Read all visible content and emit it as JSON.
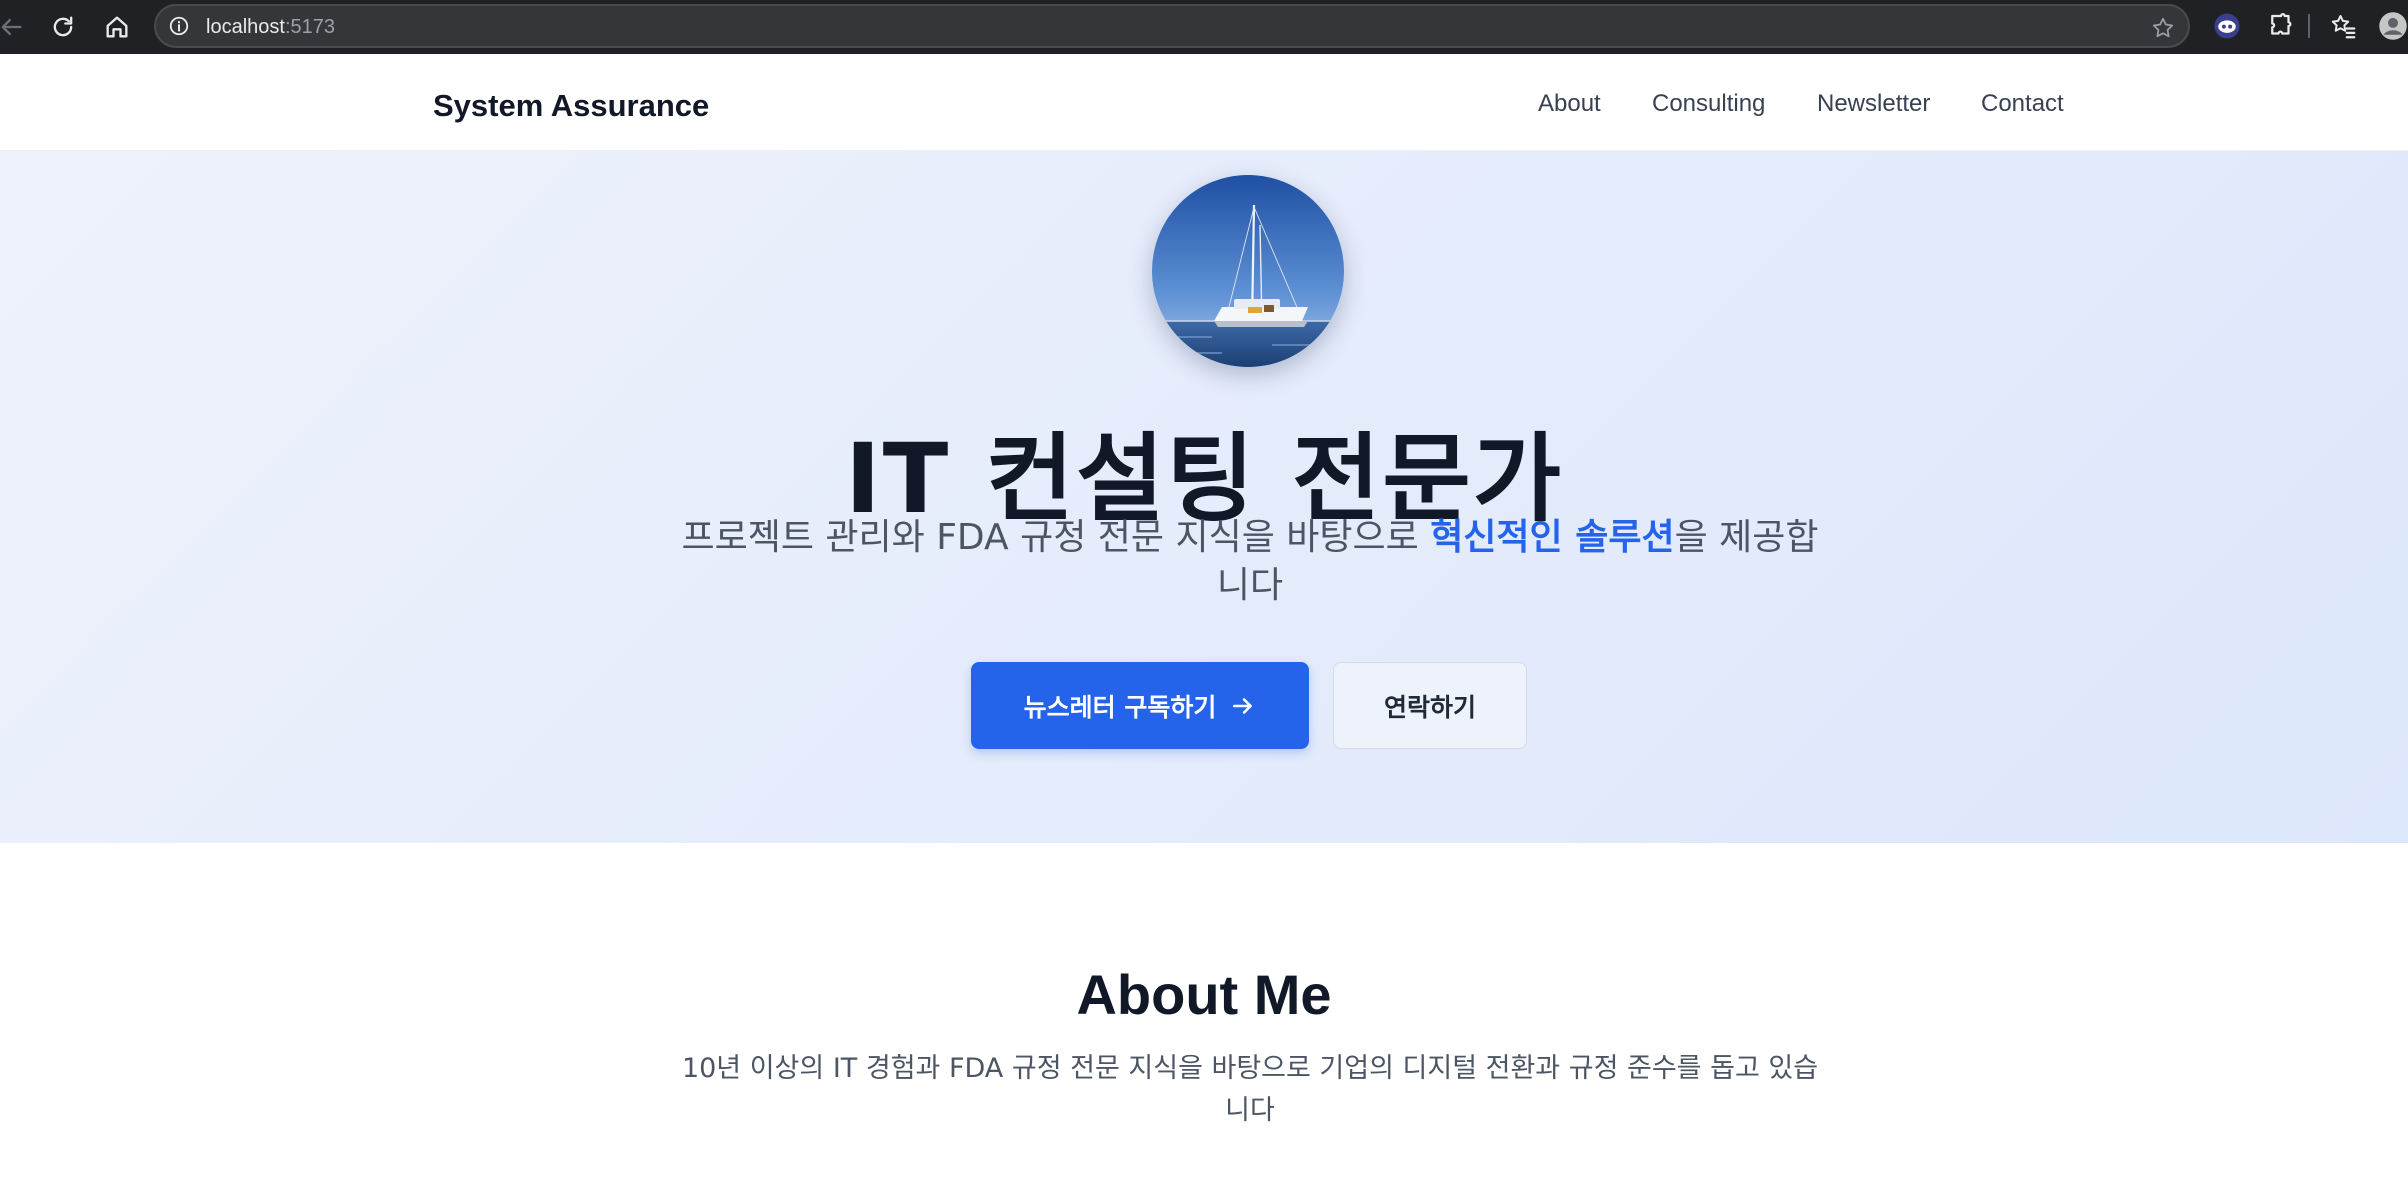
{
  "browser": {
    "url_host": "localhost",
    "url_port": ":5173",
    "icons": [
      "back-icon",
      "reload-icon",
      "home-icon",
      "info-icon",
      "star-icon",
      "extension-avatar-icon",
      "puzzle-icon",
      "bookmarks-icon",
      "profile-icon"
    ]
  },
  "header": {
    "brand": "System Assurance",
    "nav": [
      {
        "label": "About"
      },
      {
        "label": "Consulting"
      },
      {
        "label": "Newsletter"
      },
      {
        "label": "Contact"
      }
    ]
  },
  "hero": {
    "title": "IT 컨설팅 전문가",
    "subtitle_before": "프로젝트 관리와 FDA 규정 전문 지식을 바탕으로 ",
    "subtitle_highlight": "혁신적인 솔루션",
    "subtitle_after": "을 제공합니다",
    "primary_button": "뉴스레터 구독하기",
    "secondary_button": "연락하기"
  },
  "about": {
    "title": "About Me",
    "text": "10년 이상의 IT 경험과 FDA 규정 전문 지식을 바탕으로 기업의 디지털 전환과 규정 준수를 돕고 있습니다"
  },
  "colors": {
    "accent": "#2563eb",
    "text_dark": "#111827",
    "text_muted": "#4b5563",
    "chrome_bg": "#202124"
  }
}
